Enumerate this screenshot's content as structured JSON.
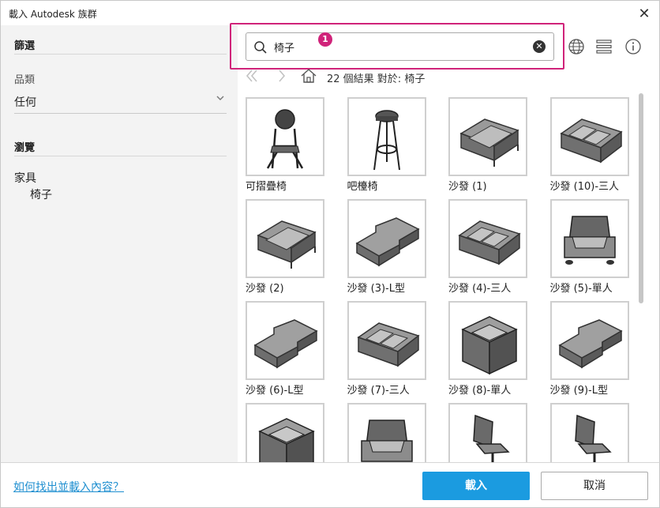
{
  "window": {
    "title": "載入 Autodesk 族群",
    "close_glyph": "✕"
  },
  "sidebar": {
    "filter_heading": "篩選",
    "category_label": "品類",
    "category_value": "任何",
    "browse_heading": "瀏覽",
    "tree": [
      {
        "label": "家具"
      },
      {
        "label": "椅子"
      }
    ]
  },
  "search": {
    "value": "椅子",
    "placeholder": "",
    "badge": "1"
  },
  "toolbar": {
    "icons": [
      "globe-icon",
      "list-view-icon",
      "info-icon"
    ]
  },
  "nav": {
    "results_text": "22 個結果 對於: 椅子"
  },
  "items": [
    {
      "label": "可摺疊椅",
      "icon": "folding-chair"
    },
    {
      "label": "吧檯椅",
      "icon": "bar-stool"
    },
    {
      "label": "沙發 (1)",
      "icon": "sofa"
    },
    {
      "label": "沙發 (10)-三人",
      "icon": "sofa-three"
    },
    {
      "label": "沙發 (2)",
      "icon": "sofa"
    },
    {
      "label": "沙發 (3)-L型",
      "icon": "sofa-l"
    },
    {
      "label": "沙發 (4)-三人",
      "icon": "sofa-three"
    },
    {
      "label": "沙發 (5)-單人",
      "icon": "armchair"
    },
    {
      "label": "沙發 (6)-L型",
      "icon": "sofa-l"
    },
    {
      "label": "沙發 (7)-三人",
      "icon": "sofa-three"
    },
    {
      "label": "沙發 (8)-單人",
      "icon": "armchair-box"
    },
    {
      "label": "沙發 (9)-L型",
      "icon": "sofa-l"
    },
    {
      "label": "",
      "icon": "armchair-box"
    },
    {
      "label": "",
      "icon": "armchair"
    },
    {
      "label": "",
      "icon": "office-chair"
    },
    {
      "label": "",
      "icon": "office-chair"
    }
  ],
  "footer": {
    "help_link": "如何找出並載入內容？",
    "load_button": "載入",
    "cancel_button": "取消"
  },
  "colors": {
    "accent": "#1b9be0",
    "highlight": "#d0237a",
    "sidebar_bg": "#f3f3f3"
  }
}
